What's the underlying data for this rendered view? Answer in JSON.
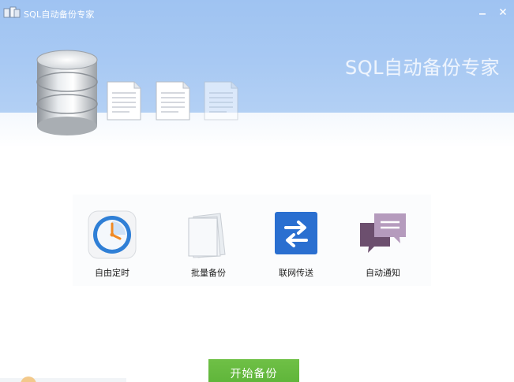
{
  "window": {
    "title": "SQL自动备份专家",
    "brand_text": "SQL自动备份专家"
  },
  "features": [
    {
      "label": "自由定时",
      "icon": "clock-icon"
    },
    {
      "label": "批量备份",
      "icon": "papers-icon"
    },
    {
      "label": "联网传送",
      "icon": "transfer-arrows-icon"
    },
    {
      "label": "自动通知",
      "icon": "chat-bubbles-icon"
    }
  ],
  "actions": {
    "start_label": "开始备份"
  },
  "colors": {
    "header_blue": "#a8c9f3",
    "start_green": "#5cb338",
    "transfer_blue": "#2a6fd0",
    "chat_purple": "#7b5d7b",
    "clock_orange": "#f08a24"
  }
}
